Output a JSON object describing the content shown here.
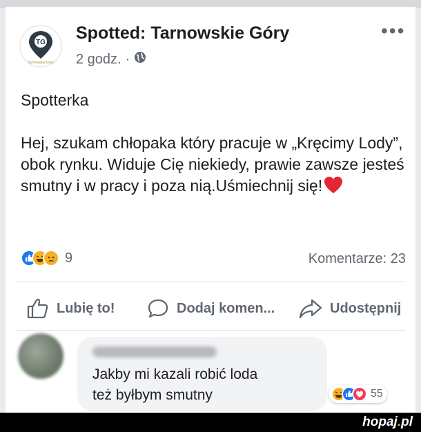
{
  "post": {
    "page_name": "Spotted: Tarnowskie Góry",
    "timestamp": "2 godz.",
    "separator": "·",
    "privacy_icon": "globe-icon",
    "avatar_text": "TG",
    "avatar_caption": "Tarnowskie Góry",
    "paragraphs": [
      "Spotterka",
      "Hej, szukam chłopaka który pracuje w „Kręcimy Lody”, obok rynku. Widuje Cię niekiedy, prawie zawsze jesteś smutny i w pracy i poza nią.Uśmiechnij się!"
    ],
    "reaction_count": "9",
    "comments_count": "Komentarze: 23"
  },
  "actions": {
    "like": "Lubię to!",
    "comment": "Dodaj komen...",
    "share": "Udostępnij"
  },
  "comment": {
    "lines": [
      "Jakby mi kazali robić loda",
      "też byłbym smutny"
    ],
    "reaction_count": "55"
  },
  "watermark": {
    "brand": "hopaj",
    "tld": "pl",
    "dot": "."
  },
  "colors": {
    "like_blue": "#1877f2",
    "love_red": "#f33e58",
    "haha_yellow": "#f7b125",
    "text_primary": "#1c1e21",
    "text_secondary": "#606770"
  }
}
